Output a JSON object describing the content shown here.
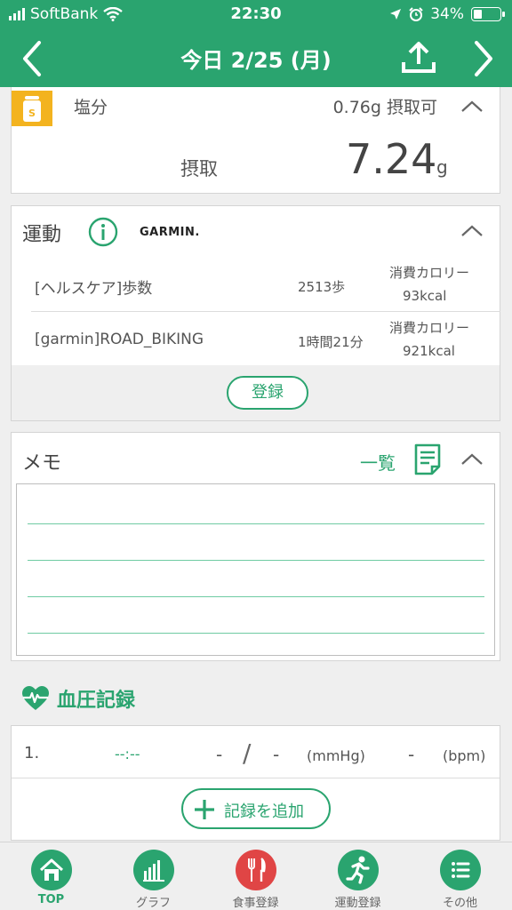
{
  "status": {
    "carrier": "SoftBank",
    "time": "22:30",
    "battery": "34%",
    "battery_level": 0.34
  },
  "header": {
    "title": "今日 2/25 (月)"
  },
  "salt": {
    "label": "塩分",
    "status": "0.76g 摂取可",
    "intake_label": "摂取",
    "value": "7.24",
    "unit": "g"
  },
  "exercise": {
    "title": "運動",
    "brand": "GARMIN.",
    "rows": [
      {
        "name": "[ヘルスケア]歩数",
        "amount": "2513歩",
        "kcal_label": "消費カロリー",
        "kcal": "93kcal"
      },
      {
        "name": "[garmin]ROAD_BIKING",
        "amount": "1時間21分",
        "kcal_label": "消費カロリー",
        "kcal": "921kcal"
      }
    ],
    "register_label": "登録"
  },
  "memo": {
    "title": "メモ",
    "list_label": "一覧"
  },
  "blood_pressure": {
    "title": "血圧記録",
    "row": {
      "index": "1.",
      "time": "--:--",
      "systolic": "-",
      "slash": "/",
      "diastolic": "-",
      "unit_mmhg": "(mmHg)",
      "pulse": "-",
      "unit_bpm": "(bpm)"
    },
    "add_label": "記録を追加"
  },
  "tabs": [
    {
      "label": "TOP",
      "icon": "home-icon",
      "active": true
    },
    {
      "label": "グラフ",
      "icon": "bar-chart-icon",
      "active": false
    },
    {
      "label": "食事登録",
      "icon": "fork-knife-icon",
      "active": false
    },
    {
      "label": "運動登録",
      "icon": "runner-icon",
      "active": false
    },
    {
      "label": "その他",
      "icon": "list-icon",
      "active": false
    }
  ],
  "colors": {
    "brand_green": "#2aa46f",
    "salt_yellow": "#f3b31f",
    "meal_red": "#e04545"
  }
}
